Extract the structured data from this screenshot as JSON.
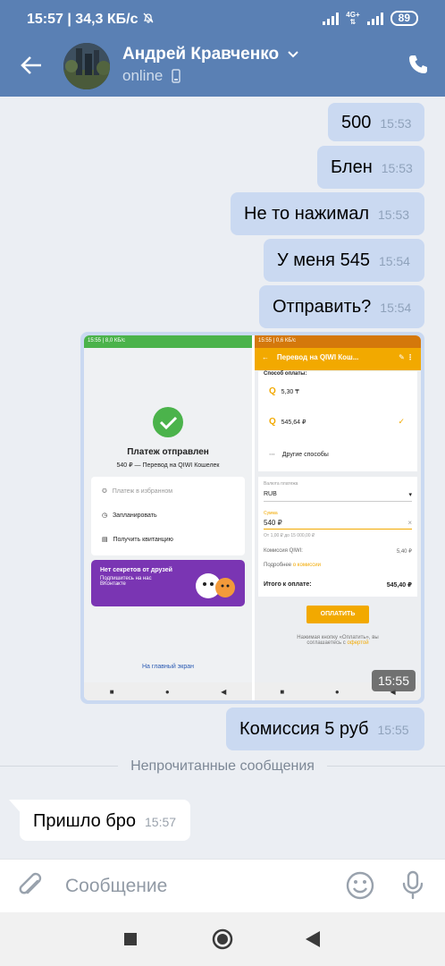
{
  "status_bar": {
    "time": "15:57",
    "speed": "34,3 КБ/с",
    "lte_top": "4G+",
    "lte_bottom": "⇅",
    "battery": "89"
  },
  "header": {
    "name": "Андрей Кравченко",
    "status": "online"
  },
  "messages": [
    {
      "text": "500",
      "time": "15:53"
    },
    {
      "text": "Блен",
      "time": "15:53"
    },
    {
      "text": "Не то нажимал",
      "time": "15:53"
    },
    {
      "text": "У меня 545",
      "time": "15:54"
    },
    {
      "text": "Отправить?",
      "time": "15:54"
    },
    {
      "text": "Комиссия 5 руб",
      "time": "15:55"
    },
    {
      "text": "Пришло бро",
      "time": "15:57"
    }
  ],
  "photo": {
    "time": "15:55",
    "left": {
      "status": "15:55 | 8,0 КБ/с",
      "title": "Платеж отправлен",
      "subtitle": "540 ₽ — Перевод на QIWI Кошелек",
      "menu": [
        "Платеж в избранном",
        "Запланировать",
        "Получить квитанцию"
      ],
      "promo_title": "Нет секретов от друзей",
      "promo_text": "Подпишитесь на нас ВКонтакте",
      "link": "На главный экран"
    },
    "right": {
      "status": "15:55 | 0,6 КБ/с",
      "title": "Перевод на QIWI Кош...",
      "method_label": "Способ оплаты:",
      "options": [
        "5,30 ₸",
        "545,64 ₽",
        "Другие способы"
      ],
      "currency_label": "Валюта платежа",
      "currency": "RUB",
      "sum_label": "Сумма",
      "sum": "540 ₽",
      "range": "От 1,00 ₽ до 15 000,00 ₽",
      "commission_label": "Комиссия QIWI:",
      "commission": "5,40 ₽",
      "more_label": "Подробнее",
      "more_link": "о комиссии",
      "total_label": "Итого к оплате:",
      "total": "545,40 ₽",
      "pay_button": "ОПЛАТИТЬ",
      "offer_text": "Нажимая кнопку «Оплатить», вы соглашаетесь с",
      "offer_link": "офертой"
    }
  },
  "divider": "Непрочитанные сообщения",
  "composer": {
    "placeholder": "Сообщение"
  },
  "colors": {
    "header": "#5a80b4",
    "outgoing": "#cad9f1",
    "incoming": "#ffffff",
    "background": "#ebeef3",
    "qiwi": "#f2a900",
    "success": "#4bb34b"
  }
}
